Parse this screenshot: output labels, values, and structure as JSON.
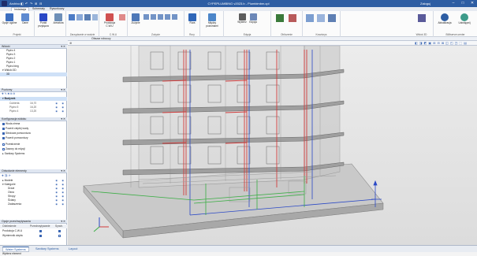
{
  "window": {
    "title": "CYPEPLUMBING v2023.b - Plumbimbm.cpl",
    "quick_access": [
      "Archivo",
      "◧",
      "↶",
      "↷",
      "⊞",
      "⊟"
    ],
    "user": "Zaloguj",
    "controls": [
      "–",
      "□",
      "✕"
    ]
  },
  "tabs": [
    "Instalacja",
    "Schematy",
    "Rysunkowy"
  ],
  "ribbon": {
    "groups": [
      {
        "label": "Projekt",
        "buttons": [
          "Opcje ogólne",
          "Dane"
        ]
      },
      {
        "label": "",
        "buttons": [
          "Punkt przyłącza",
          "Armatura"
        ]
      },
      {
        "label": "Zarządzanie w wodzie",
        "buttons": [
          "",
          "",
          "",
          ""
        ]
      },
      {
        "label": "C.W.U",
        "buttons": [
          "Produkcja C.W.U",
          ""
        ]
      },
      {
        "label": "Zużycie",
        "buttons": [
          "Zużycie",
          "",
          "",
          "",
          "",
          ""
        ]
      },
      {
        "label": "Rury",
        "buttons": [
          "Rura",
          ""
        ]
      },
      {
        "label": "",
        "buttons": [
          "Między poziomami"
        ]
      },
      {
        "label": "Edycja",
        "buttons": [
          "Wybierz",
          "Edycja"
        ]
      },
      {
        "label": "Obliczenie",
        "buttons": [
          "",
          ""
        ]
      },
      {
        "label": "Kosztorys",
        "buttons": [
          "",
          "",
          ""
        ]
      },
      {
        "label": "Widok 3D",
        "buttons": [
          ""
        ]
      },
      {
        "label": "BIMserver.center",
        "buttons": [
          "Aktualizacja",
          "Udostępnij"
        ]
      }
    ]
  },
  "panels": {
    "widoki": {
      "title": "Widoki",
      "items": [
        "Piętro 4",
        "Piętro 3",
        "Piętro 2",
        "Piętro 1",
        "Piętro bieg"
      ],
      "group_3d": "Widoki 3D",
      "selected": "3D"
    },
    "poziomy": {
      "title": "Poziomy",
      "building": "Budynek",
      "levels": [
        {
          "name": "Cubierta",
          "value": "16,70"
        },
        {
          "name": "Piętro 5",
          "value": "16,20"
        },
        {
          "name": "Piętro 4",
          "value": "13,20"
        }
      ]
    },
    "konfiguracja": {
      "title": "Konfiguracja widoku",
      "items": [
        {
          "label": "Woda zimna",
          "checked": true
        },
        {
          "label": "Powrót ciepłej wody",
          "checked": true
        },
        {
          "label": "Sieciowa pomocnicza",
          "checked": true
        },
        {
          "label": "Powrót pomocniczy",
          "checked": true
        },
        {
          "label": "Przestrzenie",
          "checked": false
        },
        {
          "label": "Zawory do edycji",
          "checked": false
        }
      ],
      "footer": "Sanitary Systems"
    },
    "odwolania": {
      "title": "Odwołanie elementy",
      "groups": [
        "Modele",
        "Kategorie"
      ],
      "items": [
        "Drzwi",
        "Okna",
        "Stropy",
        "Ściany",
        "Zadaszenia"
      ]
    },
    "opcje": {
      "title": "Opcje przechwytywania",
      "headers": [
        "Odniesienie",
        "Przechwytywanie",
        "Synch."
      ],
      "rows": [
        "Produkcja C.W.U",
        "Wymiennik ciepła"
      ]
    }
  },
  "viewport_tab": "Obszar roboczy",
  "bottom_tabs": [
    "Water Systems",
    "Sanitary Systems",
    "Layout"
  ],
  "status": "Wybierz element",
  "colors": {
    "accent": "#2d5da3",
    "pipe_red": "#d23c3c",
    "pipe_green": "#3cae46",
    "pipe_blue": "#2a48c6"
  }
}
